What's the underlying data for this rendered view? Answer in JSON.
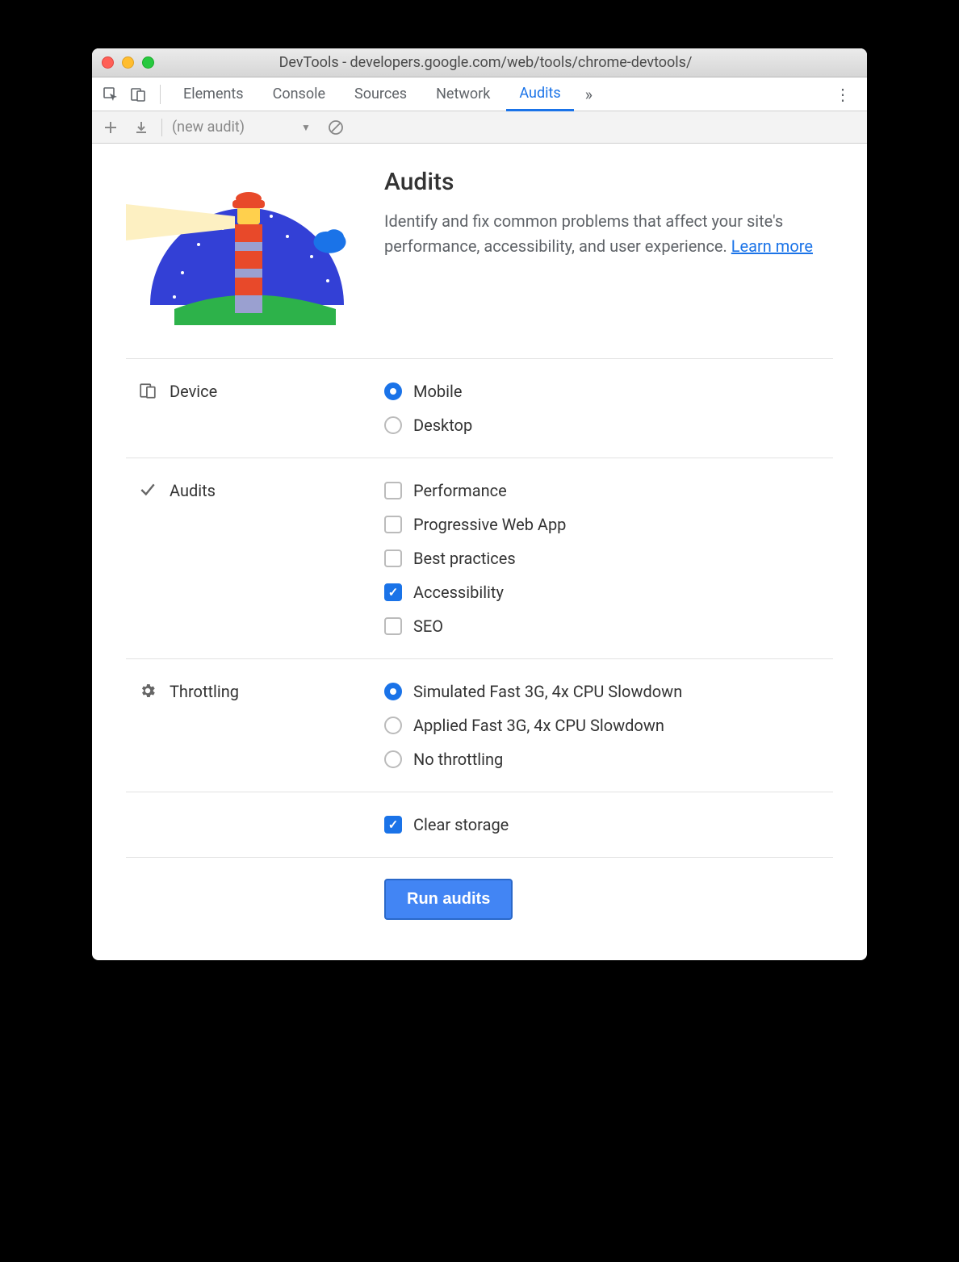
{
  "window": {
    "title": "DevTools - developers.google.com/web/tools/chrome-devtools/"
  },
  "tabs": {
    "items": [
      "Elements",
      "Console",
      "Sources",
      "Network",
      "Audits"
    ],
    "active": "Audits"
  },
  "subbar": {
    "dropdown_label": "(new audit)"
  },
  "intro": {
    "title": "Audits",
    "description": "Identify and fix common problems that affect your site's performance, accessibility, and user experience. ",
    "learn_more": "Learn more"
  },
  "sections": {
    "device": {
      "label": "Device",
      "options": [
        {
          "label": "Mobile",
          "checked": true
        },
        {
          "label": "Desktop",
          "checked": false
        }
      ]
    },
    "audits": {
      "label": "Audits",
      "options": [
        {
          "label": "Performance",
          "checked": false
        },
        {
          "label": "Progressive Web App",
          "checked": false
        },
        {
          "label": "Best practices",
          "checked": false
        },
        {
          "label": "Accessibility",
          "checked": true
        },
        {
          "label": "SEO",
          "checked": false
        }
      ]
    },
    "throttling": {
      "label": "Throttling",
      "options": [
        {
          "label": "Simulated Fast 3G, 4x CPU Slowdown",
          "checked": true
        },
        {
          "label": "Applied Fast 3G, 4x CPU Slowdown",
          "checked": false
        },
        {
          "label": "No throttling",
          "checked": false
        }
      ]
    },
    "clear_storage": {
      "label": "Clear storage",
      "checked": true
    }
  },
  "run_button": "Run audits"
}
